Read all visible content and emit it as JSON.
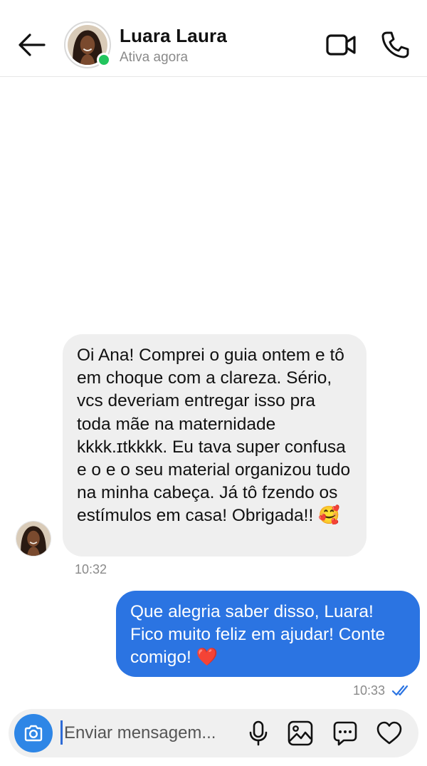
{
  "header": {
    "contact_name": "Luara Laura",
    "status": "Ativa agora",
    "icons": [
      "back-arrow-icon",
      "video-call-icon",
      "phone-icon"
    ],
    "online_color": "#22c55e"
  },
  "messages": [
    {
      "direction": "incoming",
      "text": "Oi Ana! Comprei o guia ontem e tô em choque com a clareza. Sério, vcs deveriam entregar isso pra toda mãe na maternidade kkkk.ɪtkkkk.  Eu tava super confusa e o e o seu material organizou tudo na minha cabeça. Já tô fzendo os estímulos em casa! Obrigada!! 🥰",
      "time": "10:32",
      "bubble_color": "#efefef"
    },
    {
      "direction": "outgoing",
      "text": "Que alegria saber disso, Luara! Fico muito feliz em ajudar! Conte comigo! ❤️",
      "time": "10:33",
      "read": true,
      "bubble_color": "#2b74e2"
    }
  ],
  "composer": {
    "placeholder": "Enviar mensagem...",
    "accent_color": "#2e86e6",
    "icons": [
      "camera-icon",
      "microphone-icon",
      "gallery-icon",
      "sticker-icon",
      "heart-icon"
    ]
  }
}
